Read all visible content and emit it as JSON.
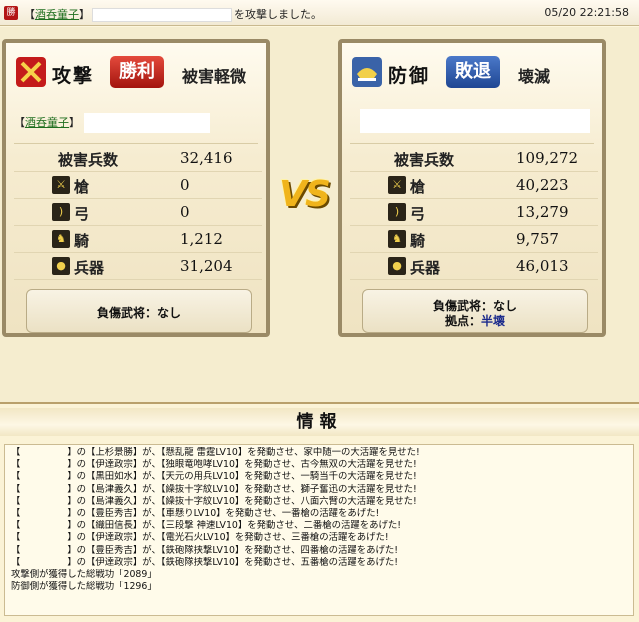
{
  "header": {
    "win_badge": "勝",
    "prefix": "【",
    "attacker_name": "酒呑童子",
    "suffix": "】",
    "message_after": "を攻撃しました。",
    "timestamp": "05/20 22:21:58"
  },
  "attacker": {
    "role": "攻撃",
    "result": "勝利",
    "damage": "被害軽微",
    "player_prefix": "【",
    "player_name": "酒呑童子",
    "player_suffix": "】",
    "stats": [
      {
        "label": "被害兵数",
        "value": "32,416",
        "icon": ""
      },
      {
        "label": "槍",
        "value": "0",
        "icon": "spear-icon"
      },
      {
        "label": "弓",
        "value": "0",
        "icon": "bow-icon"
      },
      {
        "label": "騎",
        "value": "1,212",
        "icon": "horse-icon"
      },
      {
        "label": "兵器",
        "value": "31,204",
        "icon": "siege-weapon-icon"
      }
    ],
    "injury_label": "負傷武将：なし"
  },
  "defender": {
    "role": "防御",
    "result": "敗退",
    "damage": "壊滅",
    "stats": [
      {
        "label": "被害兵数",
        "value": "109,272",
        "icon": ""
      },
      {
        "label": "槍",
        "value": "40,223",
        "icon": "spear-icon"
      },
      {
        "label": "弓",
        "value": "13,279",
        "icon": "bow-icon"
      },
      {
        "label": "騎",
        "value": "9,757",
        "icon": "horse-icon"
      },
      {
        "label": "兵器",
        "value": "46,013",
        "icon": "siege-weapon-icon"
      }
    ],
    "injury_label": "負傷武将：なし",
    "base_label": "拠点：",
    "base_status": "半壊"
  },
  "vs_label": "VS",
  "info": {
    "title": "情報",
    "lines": [
      "【　　　　　】の【上杉景勝】が、【懸乱龍 雷霆LV10】を発動させ、家中随一の大活躍を見せた!",
      "【　　　　　】の【伊達政宗】が、【独眼竜咆哮LV10】を発動させ、古今無双の大活躍を見せた!",
      "【　　　　　】の【黒田如水】が、【天元の用兵LV10】を発動させ、一騎当千の大活躍を見せた!",
      "【　　　　　】の【島津義久】が、【繰抜十字紋LV10】を発動させ、獅子奮迅の大活躍を見せた!",
      "【　　　　　】の【島津義久】が、【繰抜十字紋LV10】を発動させ、八面六臂の大活躍を見せた!",
      "【　　　　　】の【豊臣秀吉】が、【車懸りLV10】を発動させ、一番槍の活躍をあげた!",
      "【　　　　　】の【織田信長】が、【三段撃 神速LV10】を発動させ、二番槍の活躍をあげた!",
      "【　　　　　】の【伊達政宗】が、【電光石火LV10】を発動させ、三番槍の活躍をあげた!",
      "【　　　　　】の【豊臣秀吉】が、【鉄砲隊挟撃LV10】を発動させ、四番槍の活躍をあげた!",
      "【　　　　　】の【伊達政宗】が、【鉄砲隊挟撃LV10】を発動させ、五番槍の活躍をあげた!",
      "攻撃側が獲得した総戦功「2089」",
      "防御側が獲得した総戦功「1296」"
    ]
  }
}
